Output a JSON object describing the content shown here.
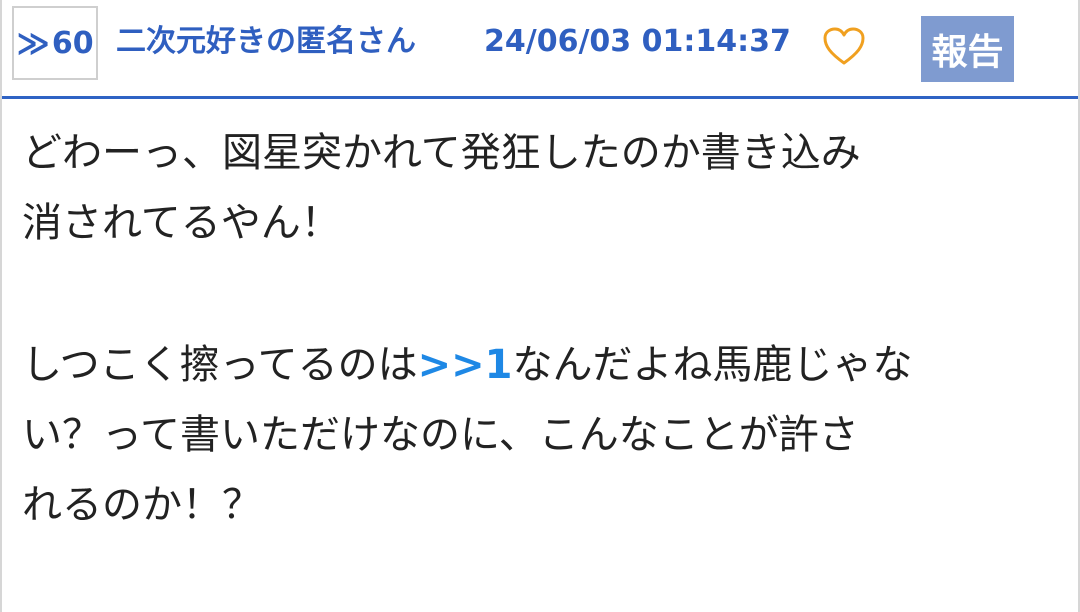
{
  "post": {
    "res_number": "60",
    "res_arrow": "≫",
    "poster_name": "二次元好きの匿名さん",
    "datetime": "24/06/03 01:14:37",
    "report_label": "報告",
    "like_icon": "heart-outline-icon",
    "colors": {
      "link": "#2f5fc0",
      "anchor": "#1e88e5",
      "report_bg": "#7f9bd0",
      "heart": "#f0a020",
      "divider": "#2f63c4"
    },
    "body": {
      "paragraph1": {
        "line1": "どわーっ、図星突かれて発狂したのか書き込み",
        "line2": "消されてるやん！"
      },
      "paragraph2": {
        "line1_before": "しつこく擦ってるのは",
        "anchor": ">>1",
        "line1_after": "なんだよね馬鹿じゃな",
        "line2": "い？って書いただけなのに、こんなことが許さ",
        "line3": "れるのか！？"
      }
    }
  }
}
